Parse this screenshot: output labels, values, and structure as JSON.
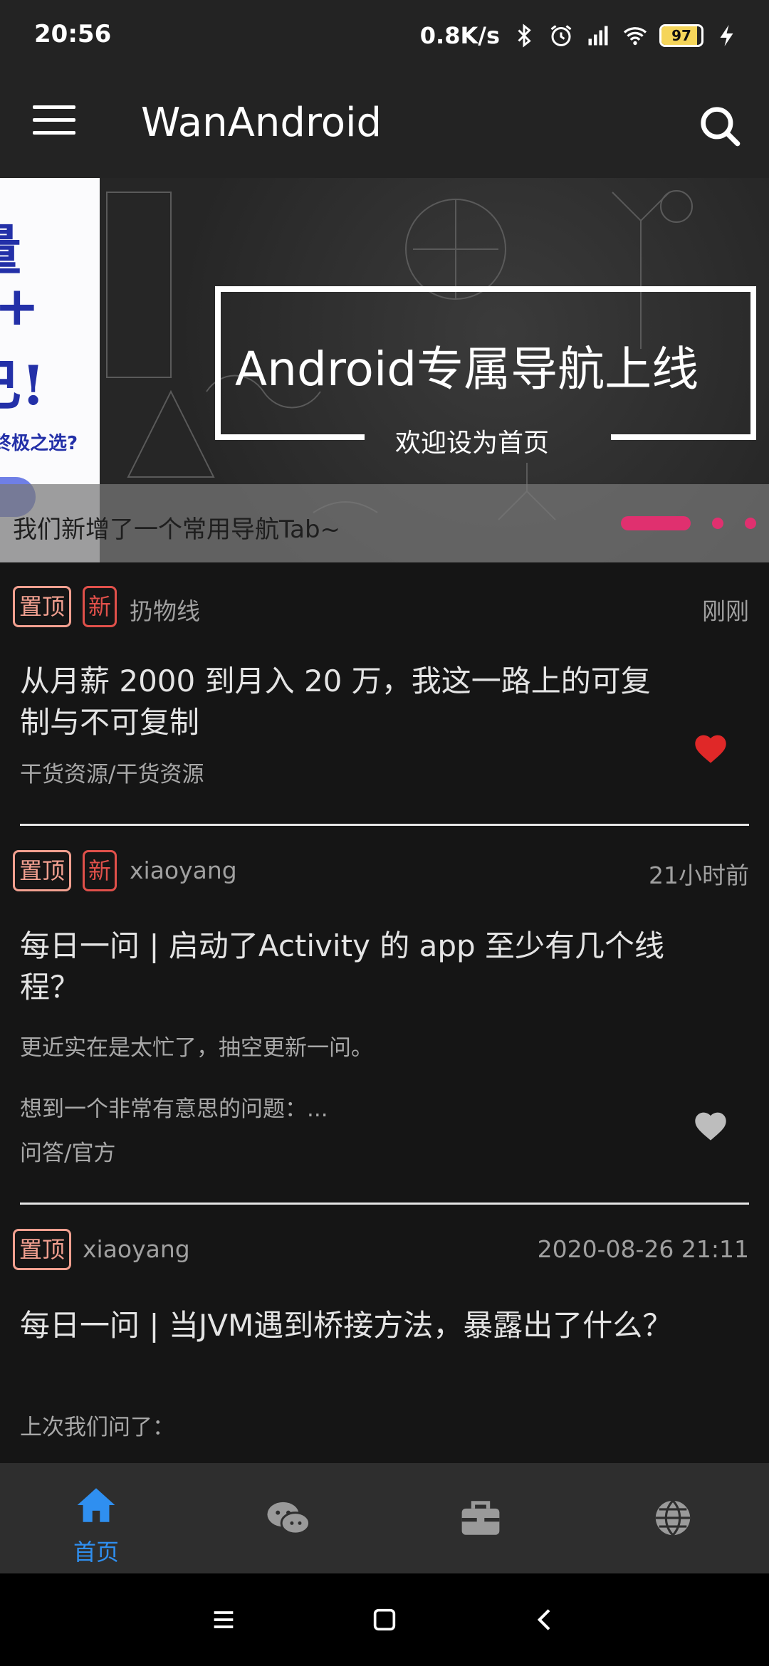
{
  "status_bar": {
    "time": "20:56",
    "net_speed": "0.8K/s",
    "battery": "97",
    "icons": [
      "bluetooth-icon",
      "alarm-icon",
      "signal-icon",
      "wifi-icon",
      "battery-icon",
      "charging-icon"
    ]
  },
  "app_bar": {
    "title": "WanAndroid",
    "menu_icon": "hamburger-menu-icon",
    "search_icon": "search-icon"
  },
  "banner": {
    "left_card_text": [
      "量",
      "+",
      "己!",
      "終极之选?"
    ],
    "headline": "Android专属导航上线",
    "subtitle": "欢迎设为首页",
    "caption": "我们新增了一个常用导航Tab~",
    "dot_color": "#e0306f"
  },
  "articles": [
    {
      "tags": [
        "置顶",
        "新"
      ],
      "author": "扔物线",
      "time": "刚刚",
      "title": "从月薪 2000 到月入 20 万，我这一路上的可复制与不可复制",
      "desc": "",
      "desc2": "",
      "category": "干货资源/干货资源",
      "liked": true
    },
    {
      "tags": [
        "置顶",
        "新"
      ],
      "author": "xiaoyang",
      "time": "21小时前",
      "title": "每日一问 | 启动了Activity 的 app 至少有几个线程？",
      "desc": "更近实在是太忙了，抽空更新一问。",
      "desc2": "想到一个非常有意思的问题：...",
      "category": "问答/官方",
      "liked": false
    },
    {
      "tags": [
        "置顶"
      ],
      "author": "xiaoyang",
      "time": "2020-08-26 21:11",
      "title": "每日一问 | 当JVM遇到桥接方法，暴露出了什么？",
      "desc": "上次我们问了：",
      "desc2": "",
      "category": "",
      "liked": false
    }
  ],
  "bottom_nav": {
    "items": [
      {
        "label": "首页",
        "icon": "home-icon",
        "active": true
      },
      {
        "label": "",
        "icon": "wechat-icon",
        "active": false
      },
      {
        "label": "",
        "icon": "briefcase-icon",
        "active": false
      },
      {
        "label": "",
        "icon": "globe-icon",
        "active": false
      }
    ],
    "active_color": "#2f8ff0",
    "inactive_color": "#9a9a9a"
  },
  "system_nav": [
    "recents-icon",
    "home-square-icon",
    "back-icon"
  ],
  "colors": {
    "heart_liked": "#e02828",
    "heart_unliked": "#bdbdbd",
    "tag_top": "#f2a090",
    "tag_new": "#e0504a"
  }
}
